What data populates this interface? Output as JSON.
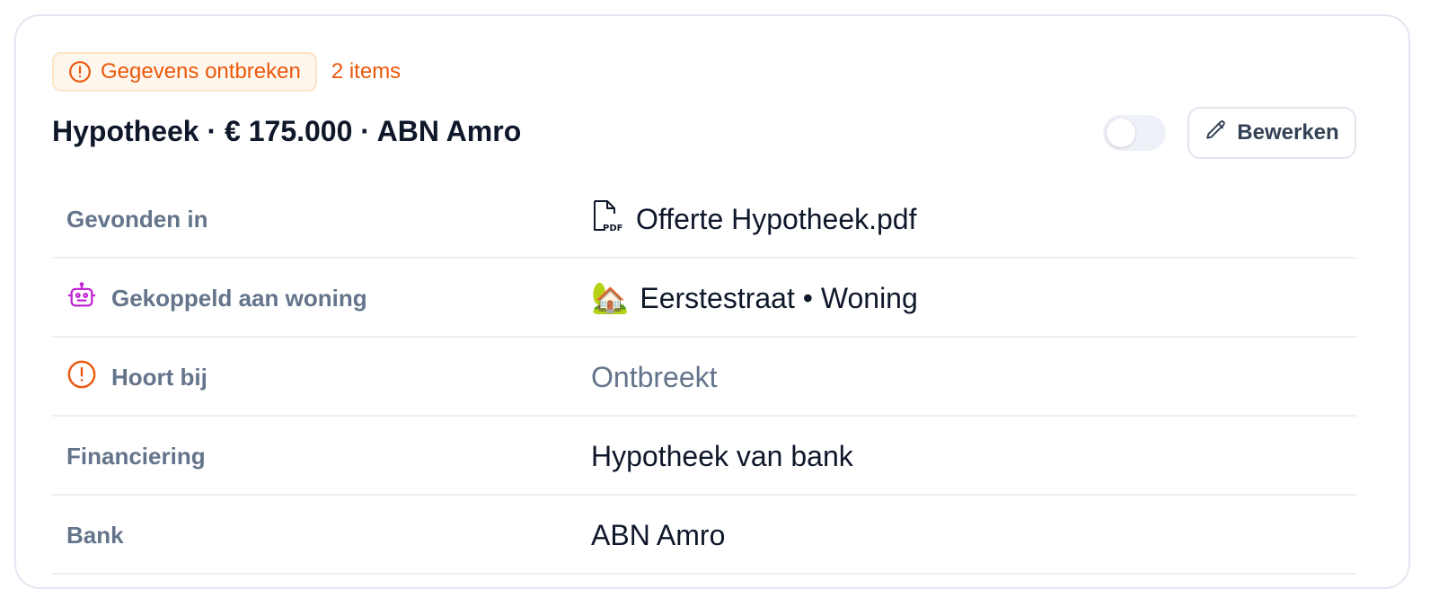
{
  "status": {
    "badge_label": "Gegevens ontbreken",
    "badge_icon": "alert-circle-icon",
    "item_count": "2 items",
    "accent_color": "#ea580c"
  },
  "header": {
    "title": "Hypotheek · € 175.000 · ABN Amro",
    "toggle_on": false,
    "edit_label": "Bewerken",
    "edit_icon": "pencil-icon"
  },
  "rows": [
    {
      "label": "Gevonden in",
      "icon": null,
      "value": "Offerte Hypotheek.pdf",
      "value_icon": "pdf-file-icon",
      "value_style": "normal"
    },
    {
      "label": "Gekoppeld aan woning",
      "icon": "robot-icon",
      "value": "Eerstestraat • Woning",
      "value_icon": "🏡",
      "value_style": "normal"
    },
    {
      "label": "Hoort bij",
      "icon": "alert-circle-icon",
      "value": "Ontbreekt",
      "value_icon": null,
      "value_style": "muted"
    },
    {
      "label": "Financiering",
      "icon": null,
      "value": "Hypotheek van bank",
      "value_icon": null,
      "value_style": "normal"
    },
    {
      "label": "Bank",
      "icon": null,
      "value": "ABN Amro",
      "value_icon": null,
      "value_style": "normal"
    }
  ]
}
